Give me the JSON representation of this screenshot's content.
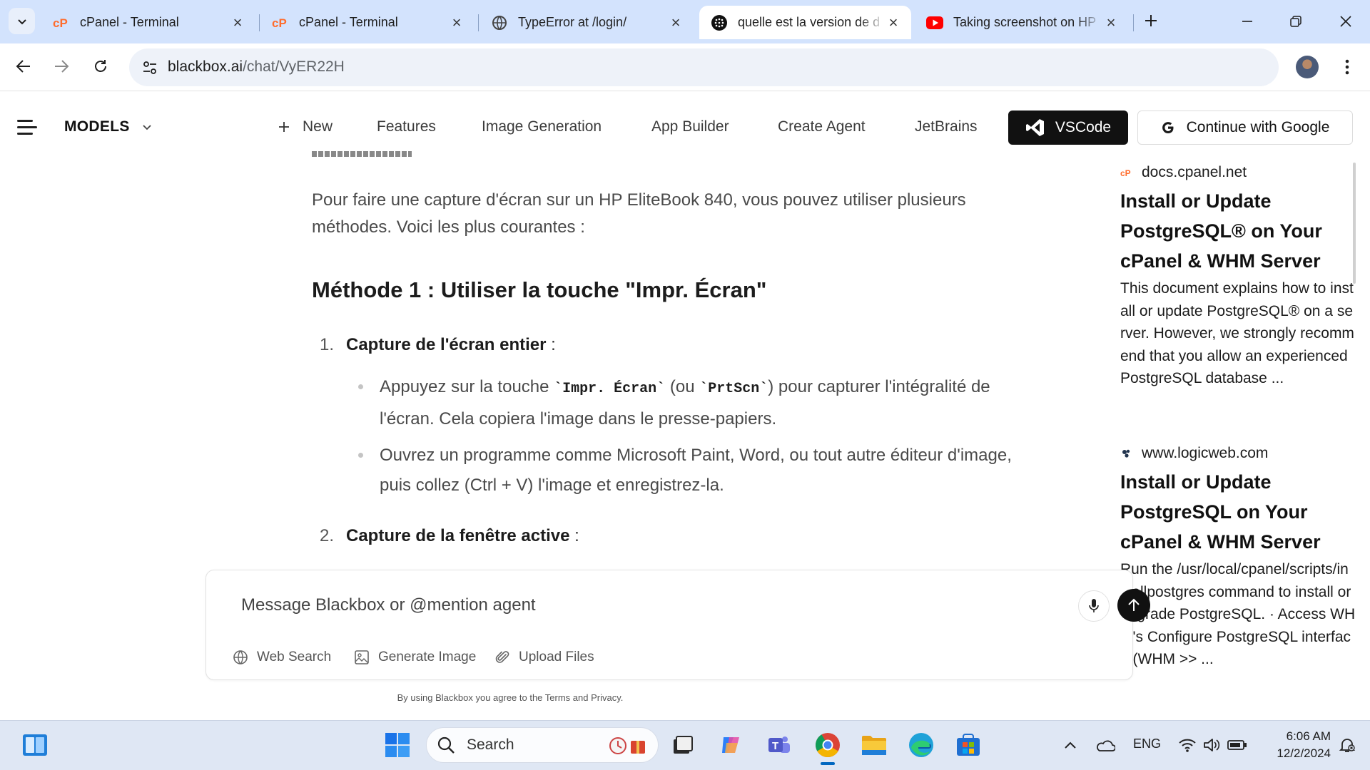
{
  "browser": {
    "tabs": [
      {
        "title": "cPanel - Terminal",
        "favicon": "cpanel-icon",
        "active": false
      },
      {
        "title": "cPanel - Terminal",
        "favicon": "cpanel-icon",
        "active": false
      },
      {
        "title": "TypeError at /login/",
        "favicon": "globe-icon",
        "active": false
      },
      {
        "title": "quelle est la version de d",
        "favicon": "blackbox-icon",
        "active": true
      },
      {
        "title": "Taking screenshot on HP",
        "favicon": "youtube-icon",
        "active": false
      }
    ],
    "url_host": "blackbox.ai",
    "url_path": "/chat/VyER22H"
  },
  "app": {
    "models_label": "MODELS",
    "nav": {
      "new": "New",
      "features": "Features",
      "image_generation": "Image Generation",
      "app_builder": "App Builder",
      "create_agent": "Create Agent",
      "jetbrains": "JetBrains"
    },
    "vscode_label": "VSCode",
    "google_label": "Continue with Google"
  },
  "chat": {
    "intro": "Pour faire une capture d'écran sur un HP EliteBook 840, vous pouvez utiliser plusieurs méthodes. Voici les plus courantes :",
    "method1_heading": "Méthode 1 : Utiliser la touche \"Impr. Écran\"",
    "item1_num": "1.",
    "item1_title": "Capture de l'écran entier",
    "item1_bullets": {
      "b1_pre": "Appuyez sur la touche ",
      "b1_key1": "`Impr. Écran`",
      "b1_mid": " (ou ",
      "b1_key2": "`PrtScn`",
      "b1_post": ") pour capturer l'intégralité de l'écran. Cela copiera l'image dans le presse-papiers.",
      "b2": "Ouvrez un programme comme Microsoft Paint, Word, ou tout autre éditeur d'image, puis collez (Ctrl + V) l'image et enregistrez-la."
    },
    "item2_num": "2.",
    "item2_title": "Capture de la fenêtre active",
    "colon": " :"
  },
  "composer": {
    "placeholder": "Message Blackbox or @mention agent",
    "web_search": "Web Search",
    "generate_image": "Generate Image",
    "upload_files": "Upload Files",
    "legal": "By using Blackbox you agree to the Terms and Privacy."
  },
  "sources": [
    {
      "site": "docs.cpanel.net",
      "title": "Install or Update PostgreSQL® on Your cPanel & WHM Server",
      "desc": "This document explains how to install or update PostgreSQL® on a server. However, we strongly recommend that you allow an experienced PostgreSQL database ..."
    },
    {
      "site": "www.logicweb.com",
      "title": "Install or Update PostgreSQL on Your cPanel & WHM Server",
      "desc": "Run the /usr/local/cpanel/scripts/installpostgres command to install or upgrade PostgreSQL. · Access WHM's Configure PostgreSQL interface (WHM >> ..."
    }
  ],
  "taskbar": {
    "search_label": "Search",
    "lang": "ENG",
    "time": "6:06 AM",
    "date": "12/2/2024"
  },
  "colors": {
    "tabstrip": "#d3e3fd",
    "taskbar": "#dfe7f4",
    "accent": "#0067c0",
    "vscode_bg": "#111111"
  }
}
